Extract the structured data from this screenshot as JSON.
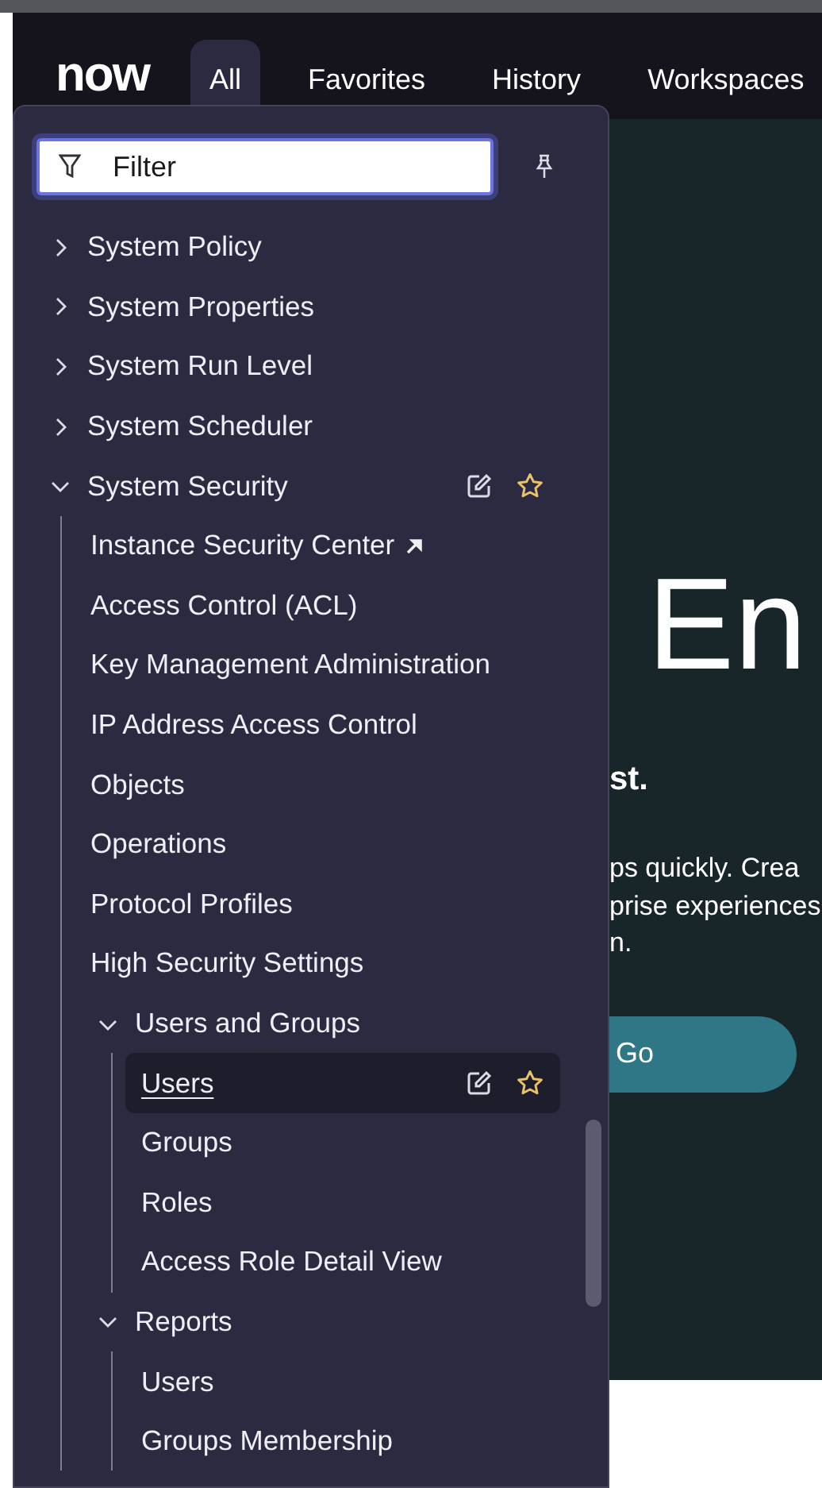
{
  "top_nav": {
    "logo": "now",
    "tabs": [
      {
        "label": "All",
        "selected": true
      },
      {
        "label": "Favorites",
        "selected": false
      },
      {
        "label": "History",
        "selected": false
      },
      {
        "label": "Workspaces",
        "selected": false
      }
    ]
  },
  "menu": {
    "filter": {
      "placeholder": "Filter"
    },
    "items": [
      {
        "label": "System Policy",
        "kind": "group",
        "expanded": false
      },
      {
        "label": "System Properties",
        "kind": "group",
        "expanded": false
      },
      {
        "label": "System Run Level",
        "kind": "group",
        "expanded": false
      },
      {
        "label": "System Scheduler",
        "kind": "group",
        "expanded": false
      },
      {
        "label": "System Security",
        "kind": "group",
        "expanded": true,
        "actions_shown": true,
        "children": [
          {
            "label": "Instance Security Center",
            "kind": "external",
            "selected": false
          },
          {
            "label": "Access Control (ACL)",
            "kind": "module",
            "selected": false
          },
          {
            "label": "Key Management Administration",
            "kind": "module",
            "selected": false
          },
          {
            "label": "IP Address Access Control",
            "kind": "module",
            "selected": false
          },
          {
            "label": "Objects",
            "kind": "module",
            "selected": false
          },
          {
            "label": "Operations",
            "kind": "module",
            "selected": false
          },
          {
            "label": "Protocol Profiles",
            "kind": "module",
            "selected": false
          },
          {
            "label": "High Security Settings",
            "kind": "module",
            "selected": false
          },
          {
            "label": "Users and Groups",
            "kind": "group",
            "expanded": true,
            "children": [
              {
                "label": "Users",
                "kind": "module",
                "selected": true,
                "actions_shown": true
              },
              {
                "label": "Groups",
                "kind": "module",
                "selected": false
              },
              {
                "label": "Roles",
                "kind": "module",
                "selected": false
              },
              {
                "label": "Access Role Detail View",
                "kind": "module",
                "selected": false
              }
            ]
          },
          {
            "label": "Reports",
            "kind": "group",
            "expanded": true,
            "children": [
              {
                "label": "Users",
                "kind": "module",
                "selected": false
              },
              {
                "label": "Groups Membership",
                "kind": "module",
                "selected": false
              }
            ]
          }
        ]
      }
    ]
  },
  "hero": {
    "heading": "En",
    "subheading": "st.",
    "description": [
      "ps quickly. Crea",
      "prise experiences",
      "n."
    ],
    "button": "Go"
  }
}
